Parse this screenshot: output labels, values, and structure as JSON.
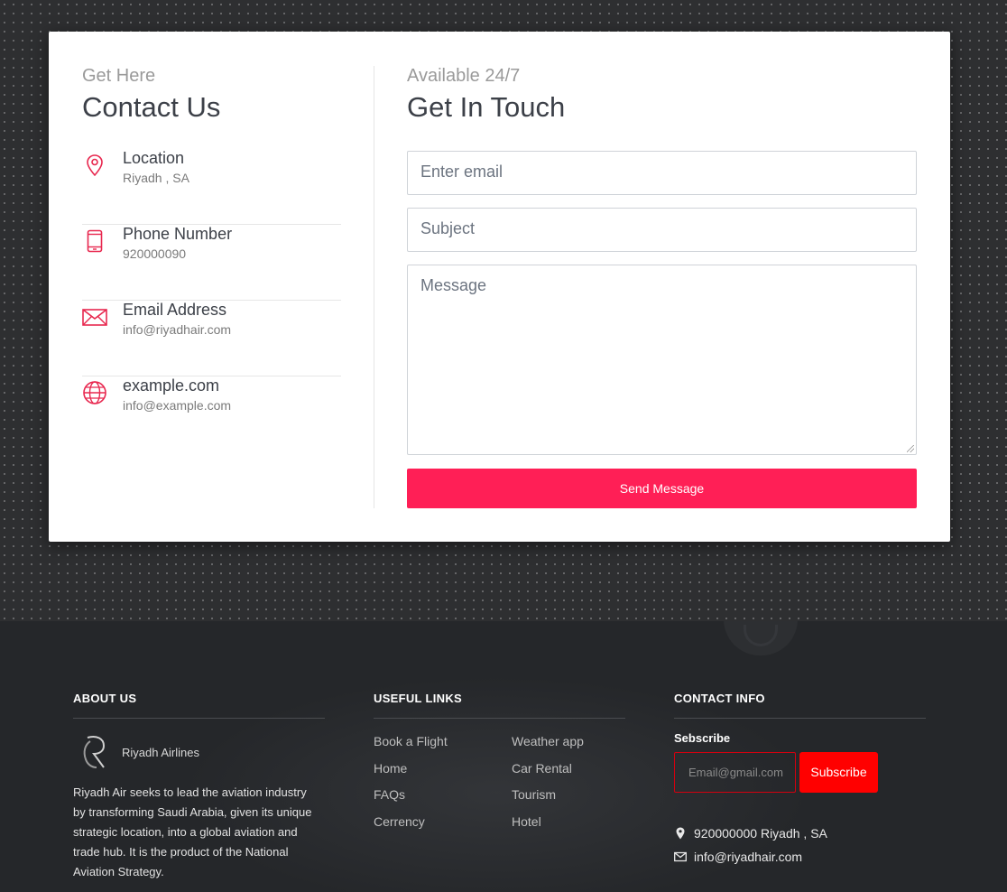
{
  "contact": {
    "eyebrow": "Get Here",
    "title": "Contact Us",
    "items": [
      {
        "icon": "location-pin-icon",
        "title": "Location",
        "value": "Riyadh , SA"
      },
      {
        "icon": "phone-icon",
        "title": "Phone Number",
        "value": "920000090"
      },
      {
        "icon": "envelope-icon",
        "title": "Email Address",
        "value": "info@riyadhair.com"
      },
      {
        "icon": "globe-icon",
        "title": "example.com",
        "value": "info@example.com"
      }
    ]
  },
  "form": {
    "eyebrow": "Available 24/7",
    "title": "Get In Touch",
    "email_placeholder": "Enter email",
    "subject_placeholder": "Subject",
    "message_placeholder": "Message",
    "send_label": "Send Message"
  },
  "footer": {
    "about": {
      "heading": "ABOUT US",
      "brand": "Riyadh Airlines",
      "text": "Riyadh Air seeks to lead the aviation industry by transforming Saudi Arabia, given its unique strategic location, into a global aviation and trade hub. It is the product of the National Aviation Strategy."
    },
    "links": {
      "heading": "USEFUL LINKS",
      "col1": [
        "Book a Flight",
        "Home",
        "FAQs",
        "Cerrency"
      ],
      "col2": [
        "Weather app",
        "Car Rental",
        "Tourism",
        "Hotel"
      ]
    },
    "contact": {
      "heading": "CONTACT INFO",
      "subscribe_label": "Sebscribe",
      "email_placeholder": "Email@gmail.com",
      "subscribe_button": "Subscribe",
      "phone_line": "920000000 Riyadh , SA",
      "email_line": "info@riyadhair.com"
    }
  },
  "colors": {
    "accent": "#ff1f56",
    "subscribe": "#ff0000",
    "footer_bg": "#25272a"
  }
}
